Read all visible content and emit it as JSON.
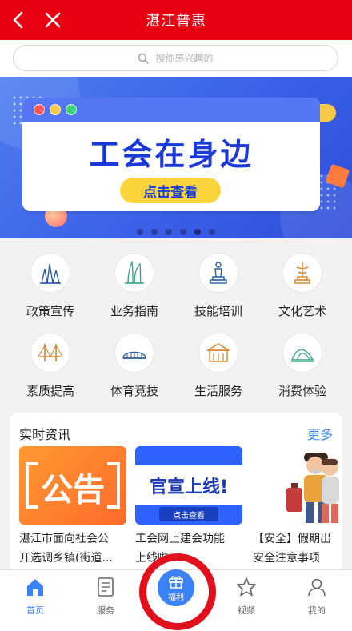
{
  "header": {
    "title": "湛江普惠",
    "back_icon": "chevron-left-icon",
    "close_icon": "close-icon"
  },
  "search": {
    "placeholder": "搜你感兴趣的"
  },
  "banner": {
    "headline": "工会在身边",
    "button_label": "点击查看",
    "slide_count": 6,
    "active_slide_index": 4,
    "colors": {
      "bg": "#3a5ee8",
      "title": "#1a3ad8",
      "button": "#f9d43d"
    }
  },
  "categories": [
    {
      "label": "政策宣传",
      "icon": "monument-icon"
    },
    {
      "label": "业务指南",
      "icon": "tower-icon"
    },
    {
      "label": "技能培训",
      "icon": "statue-icon"
    },
    {
      "label": "文化艺术",
      "icon": "sculpture-icon"
    },
    {
      "label": "素质提高",
      "icon": "bridge-icon"
    },
    {
      "label": "体育竞技",
      "icon": "stadium-icon"
    },
    {
      "label": "生活服务",
      "icon": "building-icon"
    },
    {
      "label": "消费体验",
      "icon": "sail-icon"
    }
  ],
  "news": {
    "title": "实时资讯",
    "more_label": "更多",
    "items": [
      {
        "line1": "湛江市面向社会公",
        "line2": "开选调乡镇(街道...",
        "thumb_text": "公告"
      },
      {
        "line1": "工会网上建会功能",
        "line2": "上线啦",
        "thumb_text": "官宣上线!",
        "thumb_button": "点击查看"
      },
      {
        "line1": "【安全】假期出",
        "line2": "安全注意事项",
        "thumb_text": ""
      }
    ]
  },
  "bottom_nav": {
    "items": [
      {
        "label": "首页",
        "icon": "home-icon",
        "active": true
      },
      {
        "label": "服务",
        "icon": "document-icon",
        "active": false
      },
      {
        "label": "福利",
        "icon": "gift-icon",
        "active": false
      },
      {
        "label": "视频",
        "icon": "star-icon",
        "active": false
      },
      {
        "label": "我的",
        "icon": "user-icon",
        "active": false
      }
    ]
  },
  "colors": {
    "header_red": "#e60012",
    "accent_blue": "#3b82f6",
    "annotation_ring": "#e1101c"
  }
}
